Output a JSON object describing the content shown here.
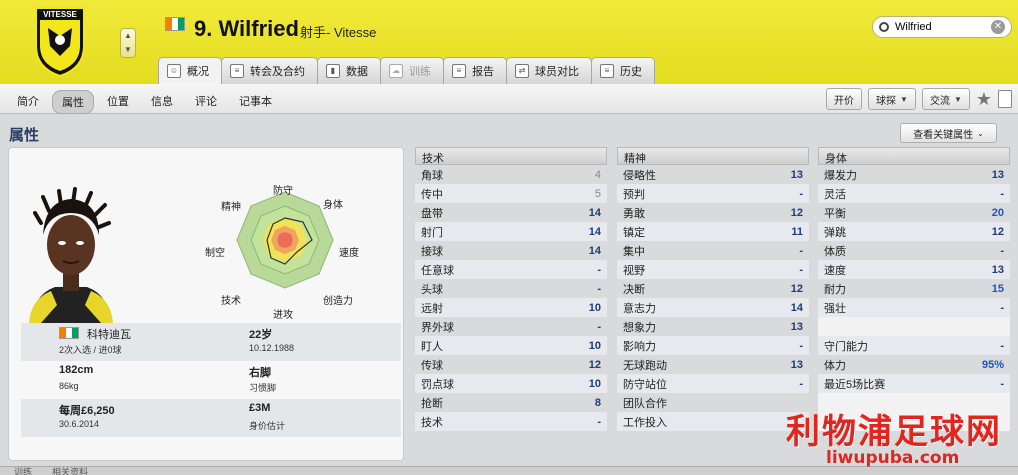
{
  "header": {
    "club_crest_text": "VITESSE",
    "player_name": "9. Wilfried",
    "player_role": "射手- Vitesse",
    "search": {
      "value": "Wilfried"
    },
    "tabs": [
      {
        "label": "概况",
        "icon": "profile-icon",
        "state": "active"
      },
      {
        "label": "转会及合约",
        "icon": "contract-icon",
        "state": "normal"
      },
      {
        "label": "数据",
        "icon": "stats-icon",
        "state": "normal"
      },
      {
        "label": "训练",
        "icon": "training-icon",
        "state": "disabled"
      },
      {
        "label": "报告",
        "icon": "report-icon",
        "state": "normal"
      },
      {
        "label": "球员对比",
        "icon": "compare-icon",
        "state": "normal"
      },
      {
        "label": "历史",
        "icon": "history-icon",
        "state": "normal"
      }
    ]
  },
  "subnav": {
    "items": [
      "简介",
      "属性",
      "位置",
      "信息",
      "评论",
      "记事本"
    ],
    "active": "属性",
    "tools": {
      "bid": "开价",
      "scout": "球探",
      "interact": "交流"
    }
  },
  "section": {
    "title": "属性",
    "key_attr_button": "查看关键属性"
  },
  "radar_labels": {
    "defense": "防守",
    "physical": "身体",
    "speed": "速度",
    "creativity": "创造力",
    "attack": "进攻",
    "technique": "技术",
    "aerial": "制空",
    "mental": "精神"
  },
  "info": {
    "nationality": "科特迪瓦",
    "caps": "2次入选 / 进0球",
    "age": "22岁",
    "dob": "10.12.1988",
    "height": "182cm",
    "weight": "86kg",
    "foot": "右脚",
    "foot_label": "习惯脚",
    "wage": "每周£6,250",
    "contract_end": "30.6.2014",
    "value": "£3M",
    "value_label": "身价估计"
  },
  "colors": {
    "flag_orange": "#f77f00",
    "flag_white": "#ffffff",
    "flag_green": "#009e60",
    "header_yellow": "#ede52d"
  },
  "technical": {
    "title": "技术",
    "rows": [
      {
        "name": "角球",
        "value": "4"
      },
      {
        "name": "传中",
        "value": "5"
      },
      {
        "name": "盘带",
        "value": "14"
      },
      {
        "name": "射门",
        "value": "14"
      },
      {
        "name": "接球",
        "value": "14"
      },
      {
        "name": "任意球",
        "value": "-"
      },
      {
        "name": "头球",
        "value": "-"
      },
      {
        "name": "远射",
        "value": "10"
      },
      {
        "name": "界外球",
        "value": "-"
      },
      {
        "name": "盯人",
        "value": "10"
      },
      {
        "name": "传球",
        "value": "12"
      },
      {
        "name": "罚点球",
        "value": "10"
      },
      {
        "name": "抢断",
        "value": "8"
      },
      {
        "name": "技术",
        "value": "-"
      }
    ]
  },
  "mental": {
    "title": "精神",
    "rows": [
      {
        "name": "侵略性",
        "value": "13"
      },
      {
        "name": "预判",
        "value": "-"
      },
      {
        "name": "勇敢",
        "value": "12"
      },
      {
        "name": "镇定",
        "value": "11"
      },
      {
        "name": "集中",
        "value": "-"
      },
      {
        "name": "视野",
        "value": "-"
      },
      {
        "name": "决断",
        "value": "12"
      },
      {
        "name": "意志力",
        "value": "14"
      },
      {
        "name": "想象力",
        "value": "13"
      },
      {
        "name": "影响力",
        "value": "-"
      },
      {
        "name": "无球跑动",
        "value": "13"
      },
      {
        "name": "防守站位",
        "value": "-"
      },
      {
        "name": "团队合作",
        "value": ""
      },
      {
        "name": "工作投入",
        "value": ""
      }
    ]
  },
  "physical": {
    "title": "身体",
    "rows": [
      {
        "name": "爆发力",
        "value": "13"
      },
      {
        "name": "灵活",
        "value": "-"
      },
      {
        "name": "平衡",
        "value": "20"
      },
      {
        "name": "弹跳",
        "value": "12"
      },
      {
        "name": "体质",
        "value": "-"
      },
      {
        "name": "速度",
        "value": "13"
      },
      {
        "name": "耐力",
        "value": "15"
      },
      {
        "name": "强壮",
        "value": "-"
      },
      {
        "name": "",
        "value": ""
      },
      {
        "name": "守门能力",
        "value": "-"
      },
      {
        "name": "体力",
        "value": "95%"
      },
      {
        "name": "最近5场比赛",
        "value": "-"
      },
      {
        "name": "",
        "value": ""
      },
      {
        "name": "",
        "value": ""
      }
    ]
  },
  "watermark": {
    "main": "利物浦足球网",
    "url": "liwupuba.com"
  },
  "bottom": {
    "left": "训练",
    "right": "相关资料"
  }
}
